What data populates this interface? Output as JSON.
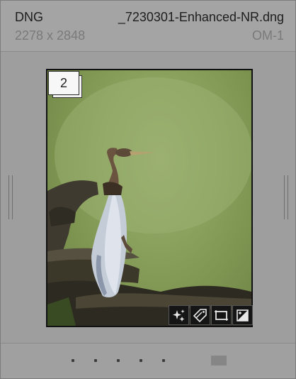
{
  "header": {
    "extension": "DNG",
    "filename": "_7230301-Enhanced-NR.dng",
    "dimensions": "2278 x 2848",
    "camera": "OM-1"
  },
  "thumbnail": {
    "stack_count": "2",
    "subject": "anhinga bird perched on driftwood",
    "background_color": "#8aa25e"
  },
  "badges": [
    {
      "icon": "develop-settings-icon"
    },
    {
      "icon": "keywords-tag-icon"
    },
    {
      "icon": "crop-icon"
    },
    {
      "icon": "exposure-adjust-icon"
    }
  ],
  "footer": {
    "rating_dots": 5,
    "color_label": "#868686"
  }
}
